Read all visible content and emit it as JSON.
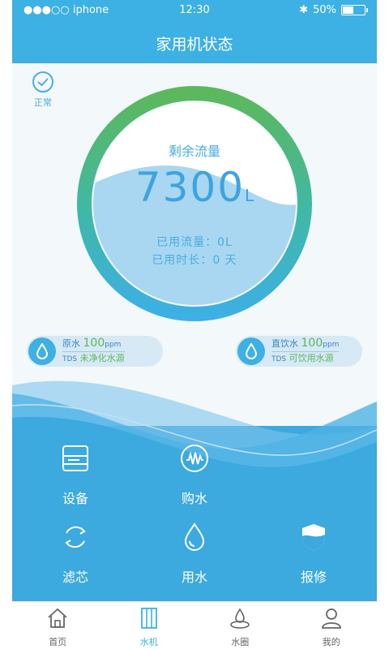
{
  "status_bar": {
    "carrier": "●●●○○ iphone",
    "time": "12:30",
    "battery": "50%"
  },
  "header": {
    "title": "家用机状态"
  },
  "device_status": "正常",
  "gauge": {
    "label": "剩余流量",
    "value": "7300",
    "unit": "L",
    "used_flow_label": "已用流量：",
    "used_flow_value": "0L",
    "used_time_label": "已用时长：",
    "used_time_value": "0 天"
  },
  "pills": {
    "raw": {
      "name": "原水",
      "value": "100",
      "unit": "ppm",
      "tds": "TDS",
      "desc": "未净化水源"
    },
    "direct": {
      "name": "直饮水",
      "value": "100",
      "unit": "ppm",
      "tds": "TDS",
      "desc": "可饮用水源"
    }
  },
  "grid": [
    {
      "label": "设备",
      "icon": "device-icon"
    },
    {
      "label": "购水",
      "icon": "buy-water-icon"
    },
    {
      "label": "滤芯",
      "icon": "filter-icon"
    },
    {
      "label": "用水",
      "icon": "water-drop-icon"
    },
    {
      "label": "报修",
      "icon": "repair-shield-icon"
    }
  ],
  "tabs": [
    {
      "label": "首页",
      "icon": "home-icon"
    },
    {
      "label": "水机",
      "icon": "water-machine-icon"
    },
    {
      "label": "水圈",
      "icon": "water-circle-icon"
    },
    {
      "label": "我的",
      "icon": "profile-icon"
    }
  ],
  "colors": {
    "accent": "#3db0e4",
    "ring_green": "#5cb85c",
    "text_blue": "#4aaddf"
  }
}
